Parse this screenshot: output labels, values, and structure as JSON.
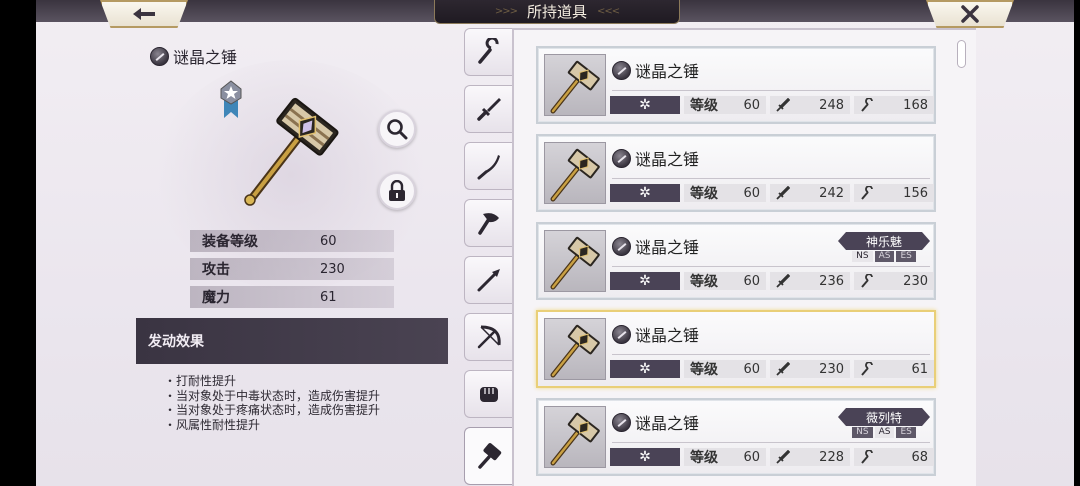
{
  "header": {
    "title": "所持道具",
    "back_icon": "back-arrow-icon",
    "close_icon": "close-icon"
  },
  "detail": {
    "name": "谜晶之锤",
    "stats": [
      {
        "label": "装备等级",
        "value": "60"
      },
      {
        "label": "攻击",
        "value": "230"
      },
      {
        "label": "魔力",
        "value": "61"
      }
    ],
    "effect_title": "发动效果",
    "effects": [
      "打耐性提升",
      "当对象处于中毒状态时，造成伤害提升",
      "当对象处于疼痛状态时，造成伤害提升",
      "风属性耐性提升"
    ]
  },
  "tabs": [
    "staff",
    "sword",
    "katana",
    "axe",
    "spear",
    "bow",
    "fist",
    "hammer"
  ],
  "list": {
    "level_label": "等级",
    "items": [
      {
        "name": "谜晶之锤",
        "element": "✲",
        "level": "60",
        "atk": "248",
        "mag": "168",
        "char": "",
        "modes": []
      },
      {
        "name": "谜晶之锤",
        "element": "✲",
        "level": "60",
        "atk": "242",
        "mag": "156",
        "char": "",
        "modes": []
      },
      {
        "name": "谜晶之锤",
        "element": "✲",
        "level": "60",
        "atk": "236",
        "mag": "230",
        "char": "神乐魅",
        "modes": [
          "NS",
          "AS",
          "ES"
        ],
        "active_mode": "NS"
      },
      {
        "name": "谜晶之锤",
        "element": "✲",
        "level": "60",
        "atk": "230",
        "mag": "61",
        "char": "",
        "modes": [],
        "selected": true
      },
      {
        "name": "谜晶之锤",
        "element": "✲",
        "level": "60",
        "atk": "228",
        "mag": "68",
        "char": "薇列特",
        "modes": [
          "NS",
          "AS",
          "ES"
        ],
        "active_mode": "AS"
      }
    ]
  },
  "colors": {
    "panel_dark": "#4a4356",
    "selected_border": "#e9cf78",
    "title_plate": "#2d2730"
  }
}
